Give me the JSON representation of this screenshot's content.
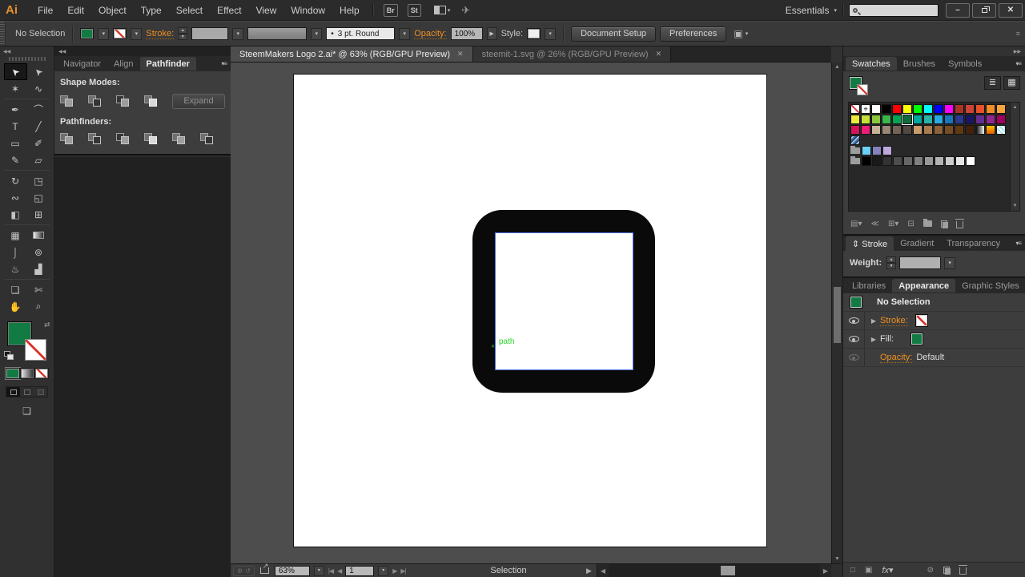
{
  "menubar": {
    "logo": "Ai",
    "items": [
      "File",
      "Edit",
      "Object",
      "Type",
      "Select",
      "Effect",
      "View",
      "Window",
      "Help"
    ],
    "br_label": "Br",
    "st_label": "St",
    "workspace_label": "Essentials"
  },
  "controlbar": {
    "selection_status": "No Selection",
    "stroke_label": "Stroke:",
    "brush_bullet": "•",
    "brush_name": "3 pt. Round",
    "opacity_label": "Opacity:",
    "opacity_value": "100%",
    "style_label": "Style:",
    "document_setup_label": "Document Setup",
    "preferences_label": "Preferences"
  },
  "toolbar": {
    "groups": [
      [
        [
          {
            "name": "selection",
            "glyph": "➤",
            "active": true
          },
          {
            "name": "direct-selection",
            "glyph": "➤"
          }
        ],
        [
          {
            "name": "magic-wand",
            "glyph": "✶"
          },
          {
            "name": "lasso",
            "glyph": "∿"
          }
        ]
      ],
      [
        [
          {
            "name": "pen",
            "glyph": "✒"
          },
          {
            "name": "curvature",
            "glyph": "⌒"
          }
        ],
        [
          {
            "name": "type",
            "glyph": "T"
          },
          {
            "name": "line-segment",
            "glyph": "╱"
          }
        ],
        [
          {
            "name": "rectangle",
            "glyph": "▭"
          },
          {
            "name": "paintbrush",
            "glyph": "✐"
          }
        ],
        [
          {
            "name": "pencil",
            "glyph": "✎"
          },
          {
            "name": "eraser",
            "glyph": "▱"
          }
        ]
      ],
      [
        [
          {
            "name": "rotate",
            "glyph": "↻"
          },
          {
            "name": "scale",
            "glyph": "◳"
          }
        ],
        [
          {
            "name": "width",
            "glyph": "∾"
          },
          {
            "name": "free-transform",
            "glyph": "◱"
          }
        ],
        [
          {
            "name": "shape-builder",
            "glyph": "◧"
          },
          {
            "name": "perspective-grid",
            "glyph": "⊞"
          }
        ]
      ],
      [
        [
          {
            "name": "mesh",
            "glyph": "▦"
          },
          {
            "name": "gradient",
            "glyph": "",
            "gradient": true
          }
        ],
        [
          {
            "name": "eyedropper",
            "glyph": "⌡"
          },
          {
            "name": "blend",
            "glyph": "⊚"
          }
        ],
        [
          {
            "name": "symbol-sprayer",
            "glyph": "♨"
          },
          {
            "name": "column-graph",
            "glyph": "▟"
          }
        ]
      ],
      [
        [
          {
            "name": "artboard",
            "glyph": "❏"
          },
          {
            "name": "slice",
            "glyph": "✄"
          }
        ],
        [
          {
            "name": "hand",
            "glyph": "✋"
          },
          {
            "name": "zoom",
            "glyph": "⌕"
          }
        ]
      ]
    ]
  },
  "left_panel": {
    "tabs": [
      "Navigator",
      "Align",
      "Pathfinder"
    ],
    "shape_modes_label": "Shape Modes:",
    "shape_modes": [
      "unite",
      "minus-front",
      "intersect",
      "exclude"
    ],
    "expand_label": "Expand",
    "pathfinders_label": "Pathfinders:",
    "pathfinders": [
      "divide",
      "trim",
      "merge",
      "crop",
      "outline",
      "minus-back"
    ]
  },
  "documents": {
    "tabs": [
      {
        "label": "SteemMakers Logo 2.ai* @ 63% (RGB/GPU Preview)",
        "close": "✕",
        "active": true
      },
      {
        "label": "steemit-1.svg @ 26% (RGB/GPU Preview)",
        "close": "✕",
        "active": false
      }
    ]
  },
  "canvas": {
    "path_label": "path",
    "cursor_mark": "✕"
  },
  "swatches_panel": {
    "tabs": [
      "Swatches",
      "Brushes",
      "Symbols"
    ],
    "rows": [
      [
        "none",
        "registration",
        "#ffffff",
        "#000000",
        "#ff0000",
        "#ffff00",
        "#00ff00",
        "#00ffff",
        "#0000ff",
        "#ff00ff",
        "#a93226",
        "#cb4335",
        "#e8502a",
        "#f28c28",
        "#f5a33c"
      ],
      [
        "#ede93b",
        "#c5e03c",
        "#8dc63f",
        "#39b54a",
        "#00a651",
        "#0e6b3a",
        "#00a99d",
        "#2ab3a6",
        "#29abe2",
        "#1b75bc",
        "#2b3990",
        "#1b1464",
        "#662d91",
        "#92278f",
        "#9e005d"
      ],
      [
        "#d4145a",
        "#ed1e79",
        "#c7b299",
        "#998675",
        "#736357",
        "#534741",
        "#c69c6d",
        "#a97c50",
        "#8c6239",
        "#754c24",
        "#603913",
        "#42210b",
        "gradient-bw",
        "gradient-orange",
        "pattern-check"
      ],
      [
        "pattern-blue"
      ],
      [
        "folder",
        "#6dcff6",
        "#8781bd",
        "#bca9dc"
      ],
      [
        "folder",
        "#000000",
        "#1a1a1a",
        "#333333",
        "#4d4d4d",
        "#666666",
        "#808080",
        "#999999",
        "#b3b3b3",
        "#cccccc",
        "#e6e6e6",
        "#ffffff"
      ]
    ],
    "selected": {
      "row": 1,
      "col": 5
    },
    "bottom_icons": [
      {
        "name": "swatch-libraries-menu-icon",
        "glyph": "▤▾"
      },
      {
        "name": "add-to-library-icon",
        "glyph": "≪"
      },
      {
        "name": "show-swatch-kinds-icon",
        "glyph": "⊞▾"
      },
      {
        "name": "swatch-options-icon",
        "glyph": "⊟"
      },
      {
        "name": "new-color-group-icon",
        "cls": "ic-folder"
      },
      {
        "name": "new-swatch-icon",
        "cls": "ic-page"
      },
      {
        "name": "delete-swatch-icon",
        "cls": "ic-trash"
      }
    ]
  },
  "stroke_panel": {
    "collapse_glyph": "⇕",
    "tabs": [
      "Stroke",
      "Gradient",
      "Transparency"
    ],
    "weight_label": "Weight:"
  },
  "appearance_panel": {
    "tabs": [
      "Libraries",
      "Appearance",
      "Graphic Styles"
    ],
    "no_selection_label": "No Selection",
    "stroke_label": "Stroke:",
    "fill_label": "Fill:",
    "opacity_label": "Opacity:",
    "opacity_value": "Default",
    "bottom_icons": [
      {
        "name": "add-new-stroke-icon",
        "glyph": "□"
      },
      {
        "name": "add-new-fill-icon",
        "glyph": "▣"
      },
      {
        "name": "add-effect-icon",
        "glyph": "fx▾",
        "cls": "fx"
      },
      {
        "name": "clear-appearance-icon",
        "glyph": "⊘",
        "cls": "push"
      },
      {
        "name": "duplicate-item-icon",
        "cls": "ic-page"
      },
      {
        "name": "delete-item-icon",
        "cls": "ic-trash"
      }
    ]
  },
  "statusbar": {
    "zoom_value": "63%",
    "artboard_value": "1",
    "status_text": "Selection"
  },
  "icons": {
    "panel_menu": "▾≡",
    "collapse_left": "◀◀",
    "collapse_right": "▶▶",
    "dropdown": "▾",
    "spin_up": "▲",
    "spin_down": "▼",
    "minimize": "–",
    "close": "✕",
    "gpu": "✈",
    "list_view": "≣",
    "grid_view": "▦",
    "registration": "⌖",
    "swap": "⇄",
    "first": "|◀",
    "prev": "◀",
    "next": "▶",
    "last": "▶|",
    "scroll_up": "▲",
    "scroll_down": "▼",
    "scroll_left": "◀",
    "scroll_right": "▶",
    "settings": "⚙",
    "reset": "↺",
    "screen_mode": "❏",
    "expander": "▶",
    "control_menu": "≡",
    "opacity_arrow": "▶",
    "status_arrow": "▶"
  },
  "colors": {
    "accent_orange": "#ef9021",
    "fill_green": "#127b43",
    "selection_blue": "#4a6fe3",
    "path_green": "#2bd42b",
    "shape_black": "#0a0a0a",
    "artboard_white": "#ffffff"
  }
}
